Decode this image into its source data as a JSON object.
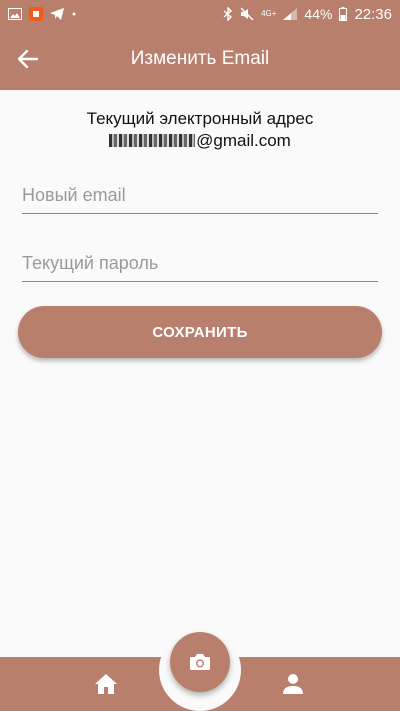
{
  "status_bar": {
    "battery": "44%",
    "time": "22:36",
    "network": "4G+",
    "left_icons": [
      "image-icon",
      "app-notification-icon",
      "telegram-icon",
      "dot-icon"
    ],
    "right_icons": [
      "bluetooth-icon",
      "mute-icon",
      "signal-icon",
      "battery-icon"
    ]
  },
  "app_bar": {
    "title": "Изменить Email",
    "back_icon": "arrow-left-icon"
  },
  "main": {
    "current_label": "Текущий электронный адрес",
    "current_email_domain": "@gmail.com",
    "new_email_placeholder": "Новый email",
    "new_email_value": "",
    "password_placeholder": "Текущий пароль",
    "password_value": "",
    "save_label": "СОХРАНИТЬ"
  },
  "bottom_nav": {
    "items": [
      "home-icon",
      "camera-icon",
      "profile-icon"
    ]
  },
  "colors": {
    "accent": "#b97f6d",
    "background": "#fafafa"
  }
}
